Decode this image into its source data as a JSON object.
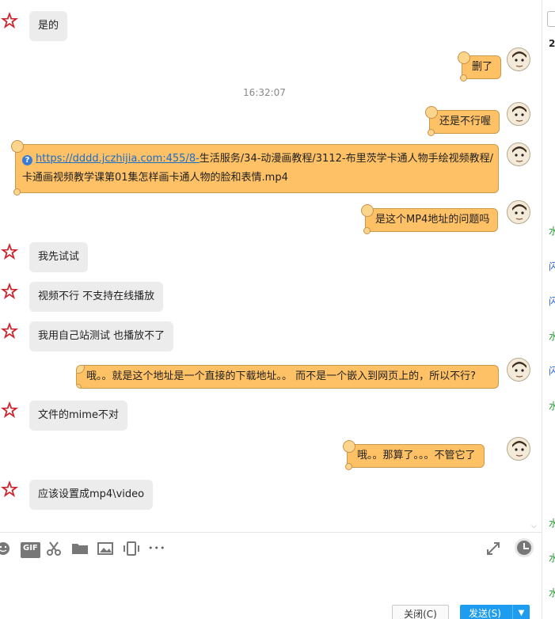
{
  "messages": [
    {
      "side": "left",
      "text": "是的"
    },
    {
      "side": "right",
      "text": "删了"
    },
    {
      "side": "right",
      "text": "还是不行喔"
    },
    {
      "side": "right",
      "link": "https://dddd.jczhijia.com:455/8-",
      "text_line1": "生活服务/34-动漫画教程/3112-布里茨学卡通人物手绘视频教程/",
      "text_line2": "卡通画视频教学课第01集怎样画卡通人物的脸和表情.mp4"
    },
    {
      "side": "right",
      "text": "是这个MP4地址的问题吗"
    },
    {
      "side": "left",
      "text": "我先试试"
    },
    {
      "side": "left",
      "text": "视频不行 不支持在线播放"
    },
    {
      "side": "left",
      "text": "我用自己站测试 也播放不了"
    },
    {
      "side": "right",
      "text": "哦。。就是这个地址是一个直接的下载地址。。 而不是一个嵌入到网页上的，所以不行?"
    },
    {
      "side": "left",
      "text": "文件的mime不对"
    },
    {
      "side": "right",
      "text": "哦。。那算了。。。不管它了"
    },
    {
      "side": "left",
      "text": "应该设置成mp4\\video"
    }
  ],
  "timestamp": "16:32:07",
  "toolbar": {
    "gif_label": "GIF",
    "more_label": "•••",
    "close_label": "关闭(C)",
    "send_label": "发送(S)"
  },
  "right_strip": [
    "2",
    "水",
    "闪",
    "闪",
    "水",
    "闪",
    "水",
    "水",
    "水",
    "水"
  ],
  "colors": {
    "right_bubble": "#ffc166",
    "left_bubble": "#ececec",
    "send_button": "#1e9cf0",
    "link": "#1a6dc8"
  }
}
